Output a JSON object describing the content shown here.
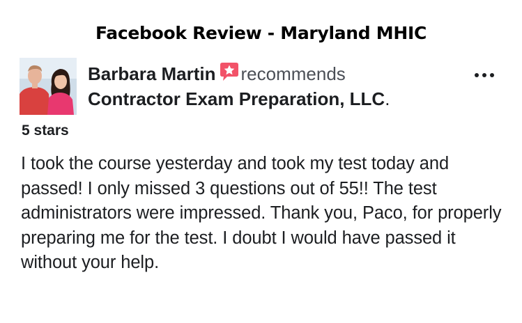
{
  "page_title": "Facebook Review - Maryland MHIC",
  "post": {
    "author": "Barbara Martin",
    "action": "recommends",
    "page_name": "Contractor Exam Preparation,  LLC",
    "page_name_suffix": ".",
    "rating": "5 stars",
    "review_text": "I took the course yesterday and took my test today and passed! I only missed 3 questions out of 55!! The test administrators were impressed. Thank you, Paco, for properly preparing me for the test. I doubt I would have passed it without your help."
  },
  "icons": {
    "recommend": "recommend-star-icon",
    "more": "more-options-icon"
  },
  "colors": {
    "recommend_badge": "#f25268",
    "text": "#1c1e21",
    "secondary_text": "#4b4f56"
  }
}
